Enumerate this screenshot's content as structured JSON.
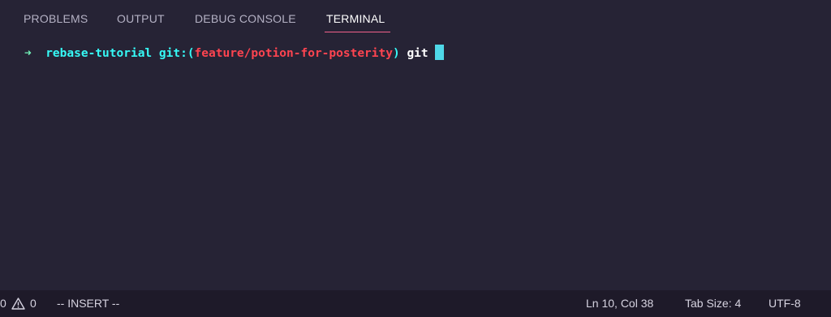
{
  "panel": {
    "tabs": [
      {
        "label": "PROBLEMS"
      },
      {
        "label": "OUTPUT"
      },
      {
        "label": "DEBUG CONSOLE"
      },
      {
        "label": "TERMINAL"
      }
    ],
    "active_tab": "TERMINAL",
    "accent_color": "#f2618b"
  },
  "terminal": {
    "prompt_arrow": "➜",
    "directory": "rebase-tutorial",
    "git_label": "git:",
    "paren_open": "(",
    "branch": "feature/potion-for-posterity",
    "paren_close": ")",
    "command": "git",
    "colors": {
      "directory": "#36f9f6",
      "branch": "#fe4450",
      "arrow": "#72f1b8",
      "cursor": "#4fd8e8"
    }
  },
  "statusbar": {
    "errors_count": "0",
    "warnings_count": "0",
    "mode": "-- INSERT --",
    "cursor_position": "Ln 10, Col 38",
    "tab_size": "Tab Size: 4",
    "encoding": "UTF-8"
  }
}
